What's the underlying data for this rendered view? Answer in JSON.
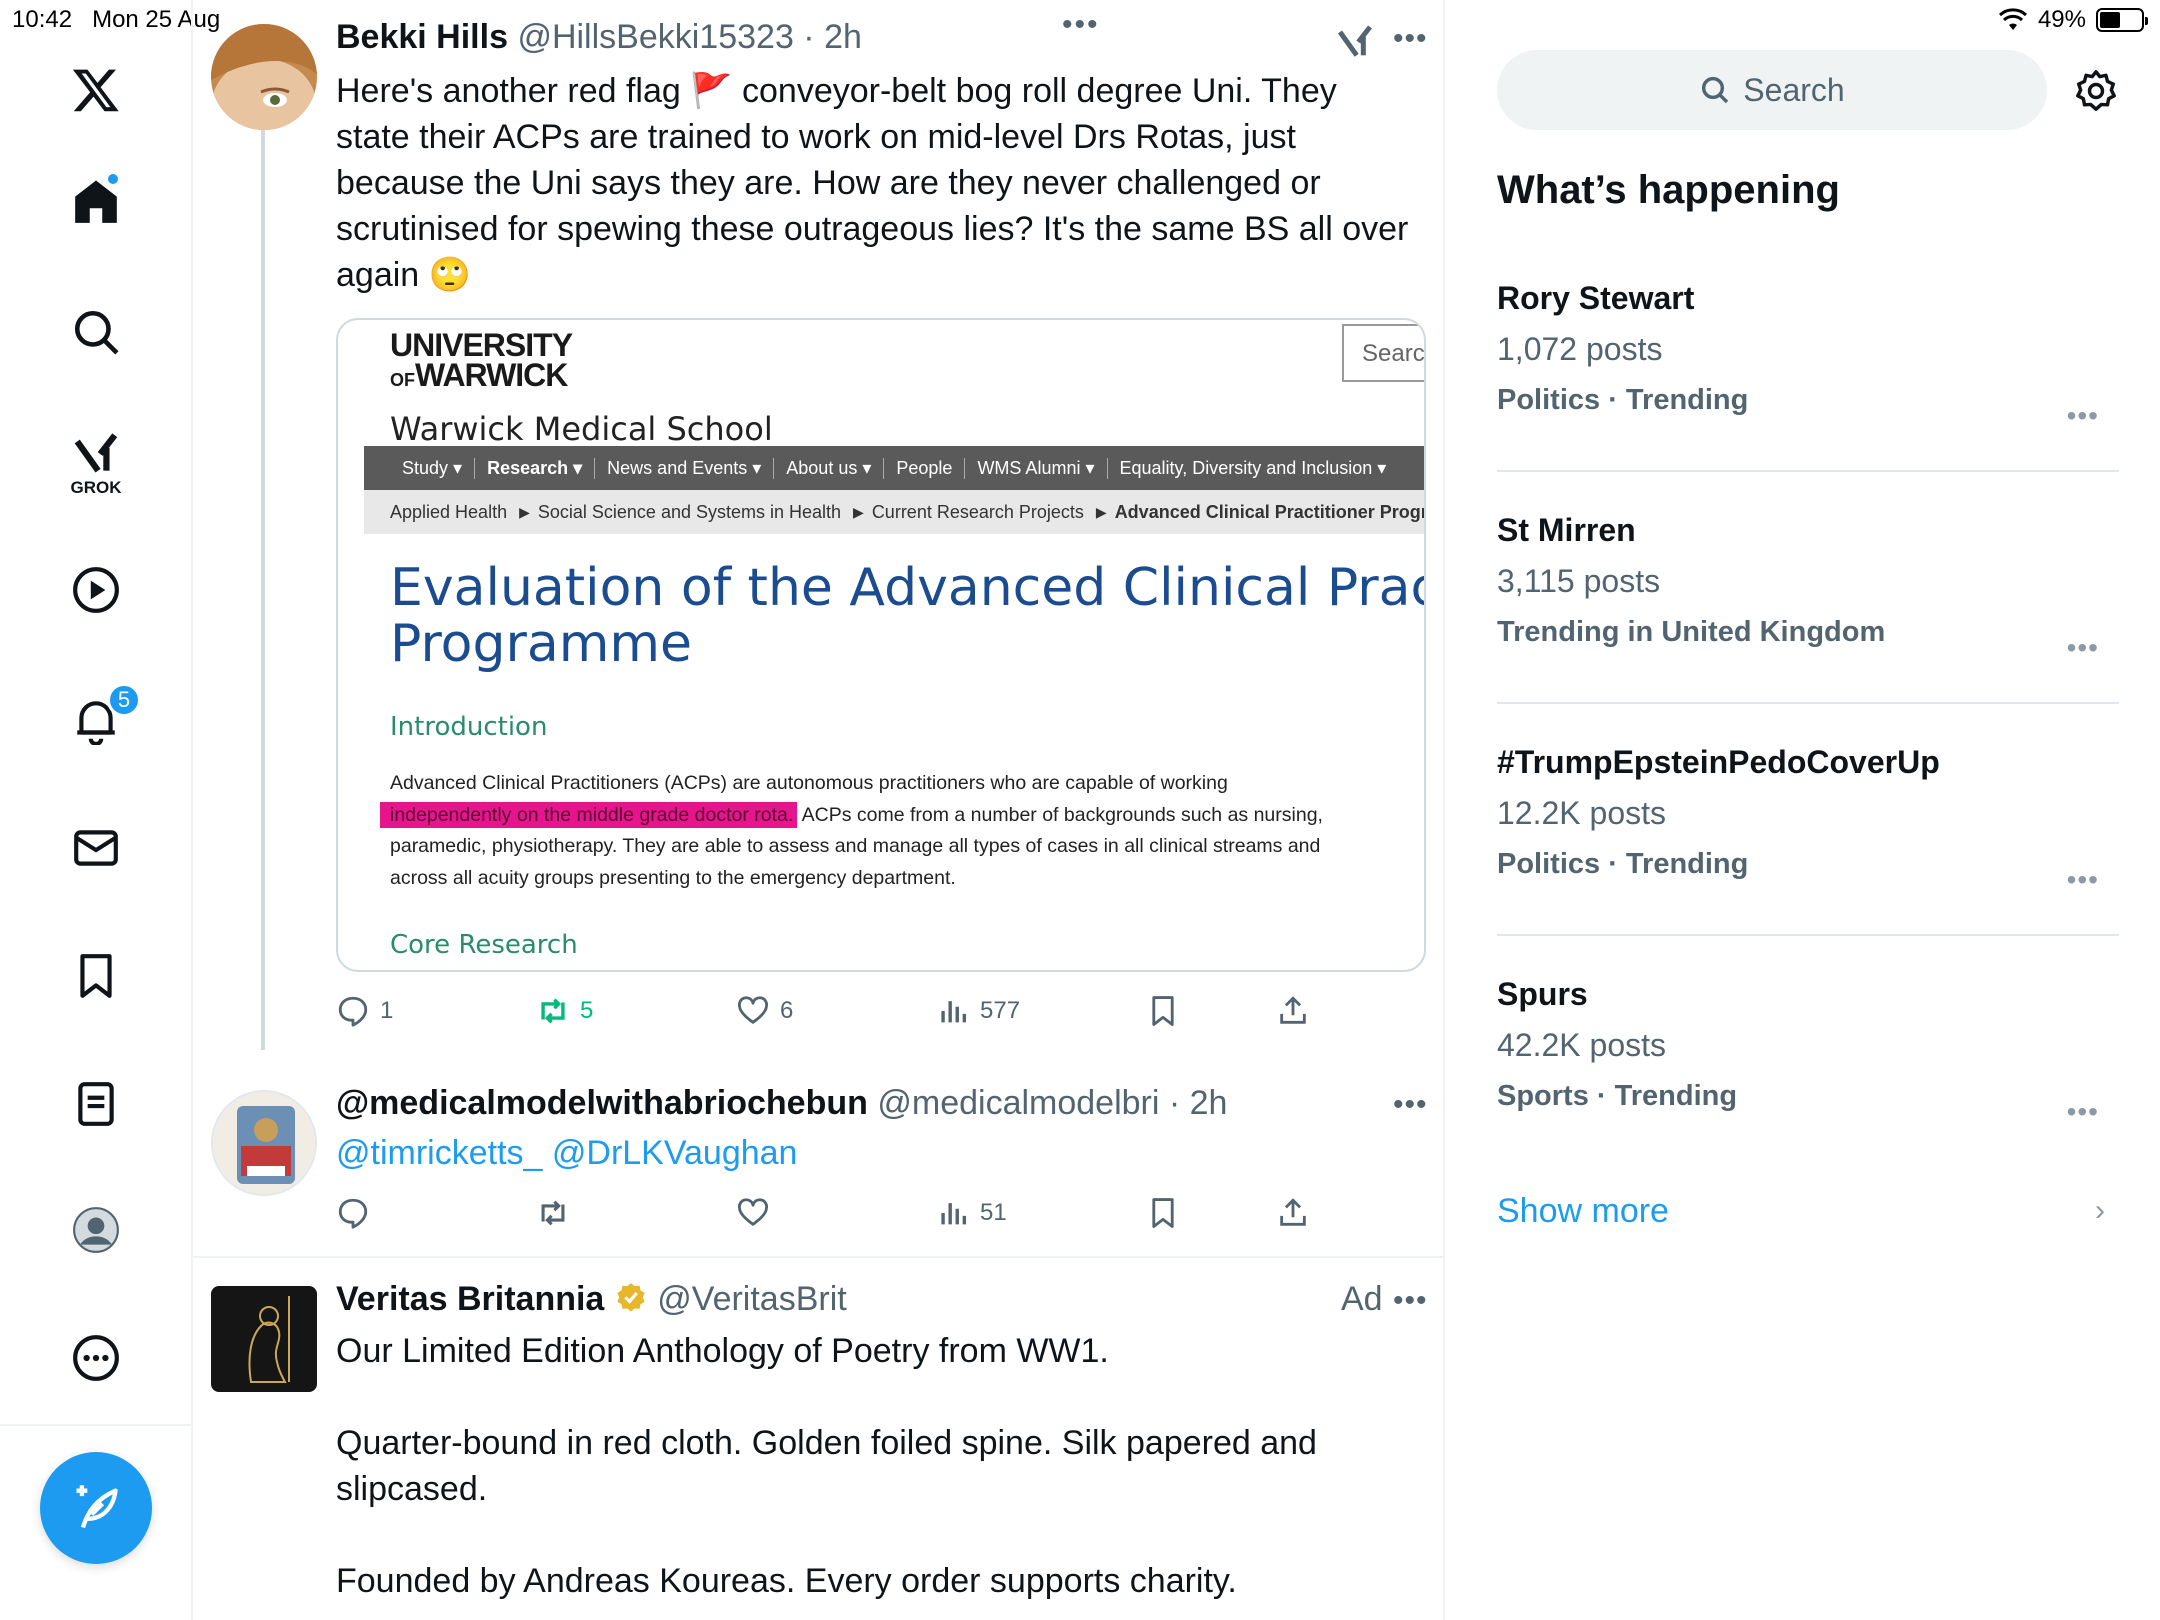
{
  "status": {
    "time": "10:42",
    "date": "Mon 25 Aug",
    "battery": "49%",
    "battery_level": 0.49
  },
  "nav": {
    "items": [
      "x-logo",
      "home",
      "search",
      "grok",
      "videos",
      "notifications",
      "messages",
      "bookmarks",
      "lists",
      "profile",
      "more"
    ],
    "grok_label": "GROK",
    "notifications_badge": "5"
  },
  "tweet1": {
    "name": "Bekki Hills",
    "handle": "@HillsBekki15323",
    "time": "2h",
    "text_lines": [
      "Here's another red flag 🚩 conveyor-belt bog roll degree Uni. They",
      "state their ACPs are trained to work on mid-level Drs Rotas, just",
      "because the Uni says they are. How are they never challenged or",
      "scrutinised for spewing these outrageous lies? It's the same BS all over",
      "again 🙄"
    ],
    "card": {
      "logo_line1": "UNIVERSITY",
      "logo_of": "OF",
      "logo_line2": "WARWICK",
      "search_placeholder": "Searc",
      "school": "Warwick Medical School",
      "menu": [
        "Study ▾",
        "Research ▾",
        "News and Events ▾",
        "About us ▾",
        "People",
        "WMS Alumni ▾",
        "Equality, Diversity and Inclusion ▾"
      ],
      "breadcrumbs": [
        "Applied Health",
        "Social Science and Systems in Health",
        "Current Research Projects",
        "Advanced Clinical Practitioner Progra"
      ],
      "title_line1": "Evaluation of the Advanced Clinical Practit",
      "title_line2": "Programme",
      "intro_heading": "Introduction",
      "body_pre": "Advanced Clinical Practitioners (ACPs) are autonomous practitioners who are capable of working",
      "body_highlight": "independently on the middle grade doctor rota.",
      "body_post1": " ACPs come from a number of backgrounds such as nursing,",
      "body_line3": "paramedic, physiotherapy. They are able to assess and manage all types of cases in all clinical streams and",
      "body_line4": "across all acuity groups presenting to the emergency department.",
      "core_heading": "Core Research",
      "highlight_color": "#e6158b"
    },
    "stats": {
      "replies": "1",
      "reposts": "5",
      "likes": "6",
      "views": "577"
    }
  },
  "tweet2": {
    "name": "@medicalmodelwithabriochebun",
    "handle": "@medicalmodelbri",
    "time": "2h",
    "mentions": "@timricketts_ @DrLKVaughan",
    "stats": {
      "views": "51"
    }
  },
  "tweet3": {
    "name": "Veritas Britannia",
    "handle": "@VeritasBrit",
    "ad_label": "Ad",
    "line1": "Our Limited Edition Anthology of Poetry from WW1.",
    "line2": "Quarter-bound in red cloth. Golden foiled spine. Silk papered and",
    "line3": "slipcased.",
    "line4": "Founded by Andreas Koureas. Every order supports charity."
  },
  "sidebar": {
    "search_placeholder": "Search",
    "section_title": "What’s happening",
    "trends": [
      {
        "name": "Rory Stewart",
        "posts": "1,072 posts",
        "category": "Politics · Trending"
      },
      {
        "name": "St Mirren",
        "posts": "3,115 posts",
        "category": "Trending in United Kingdom"
      },
      {
        "name": "#TrumpEpsteinPedoCoverUp",
        "posts": "12.2K posts",
        "category": "Politics · Trending"
      },
      {
        "name": "Spurs",
        "posts": "42.2K posts",
        "category": "Sports · Trending"
      }
    ],
    "show_more": "Show more"
  },
  "colors": {
    "accent": "#1d9bf0",
    "repost_green": "#00ba7c",
    "secondary_text": "#536471"
  }
}
